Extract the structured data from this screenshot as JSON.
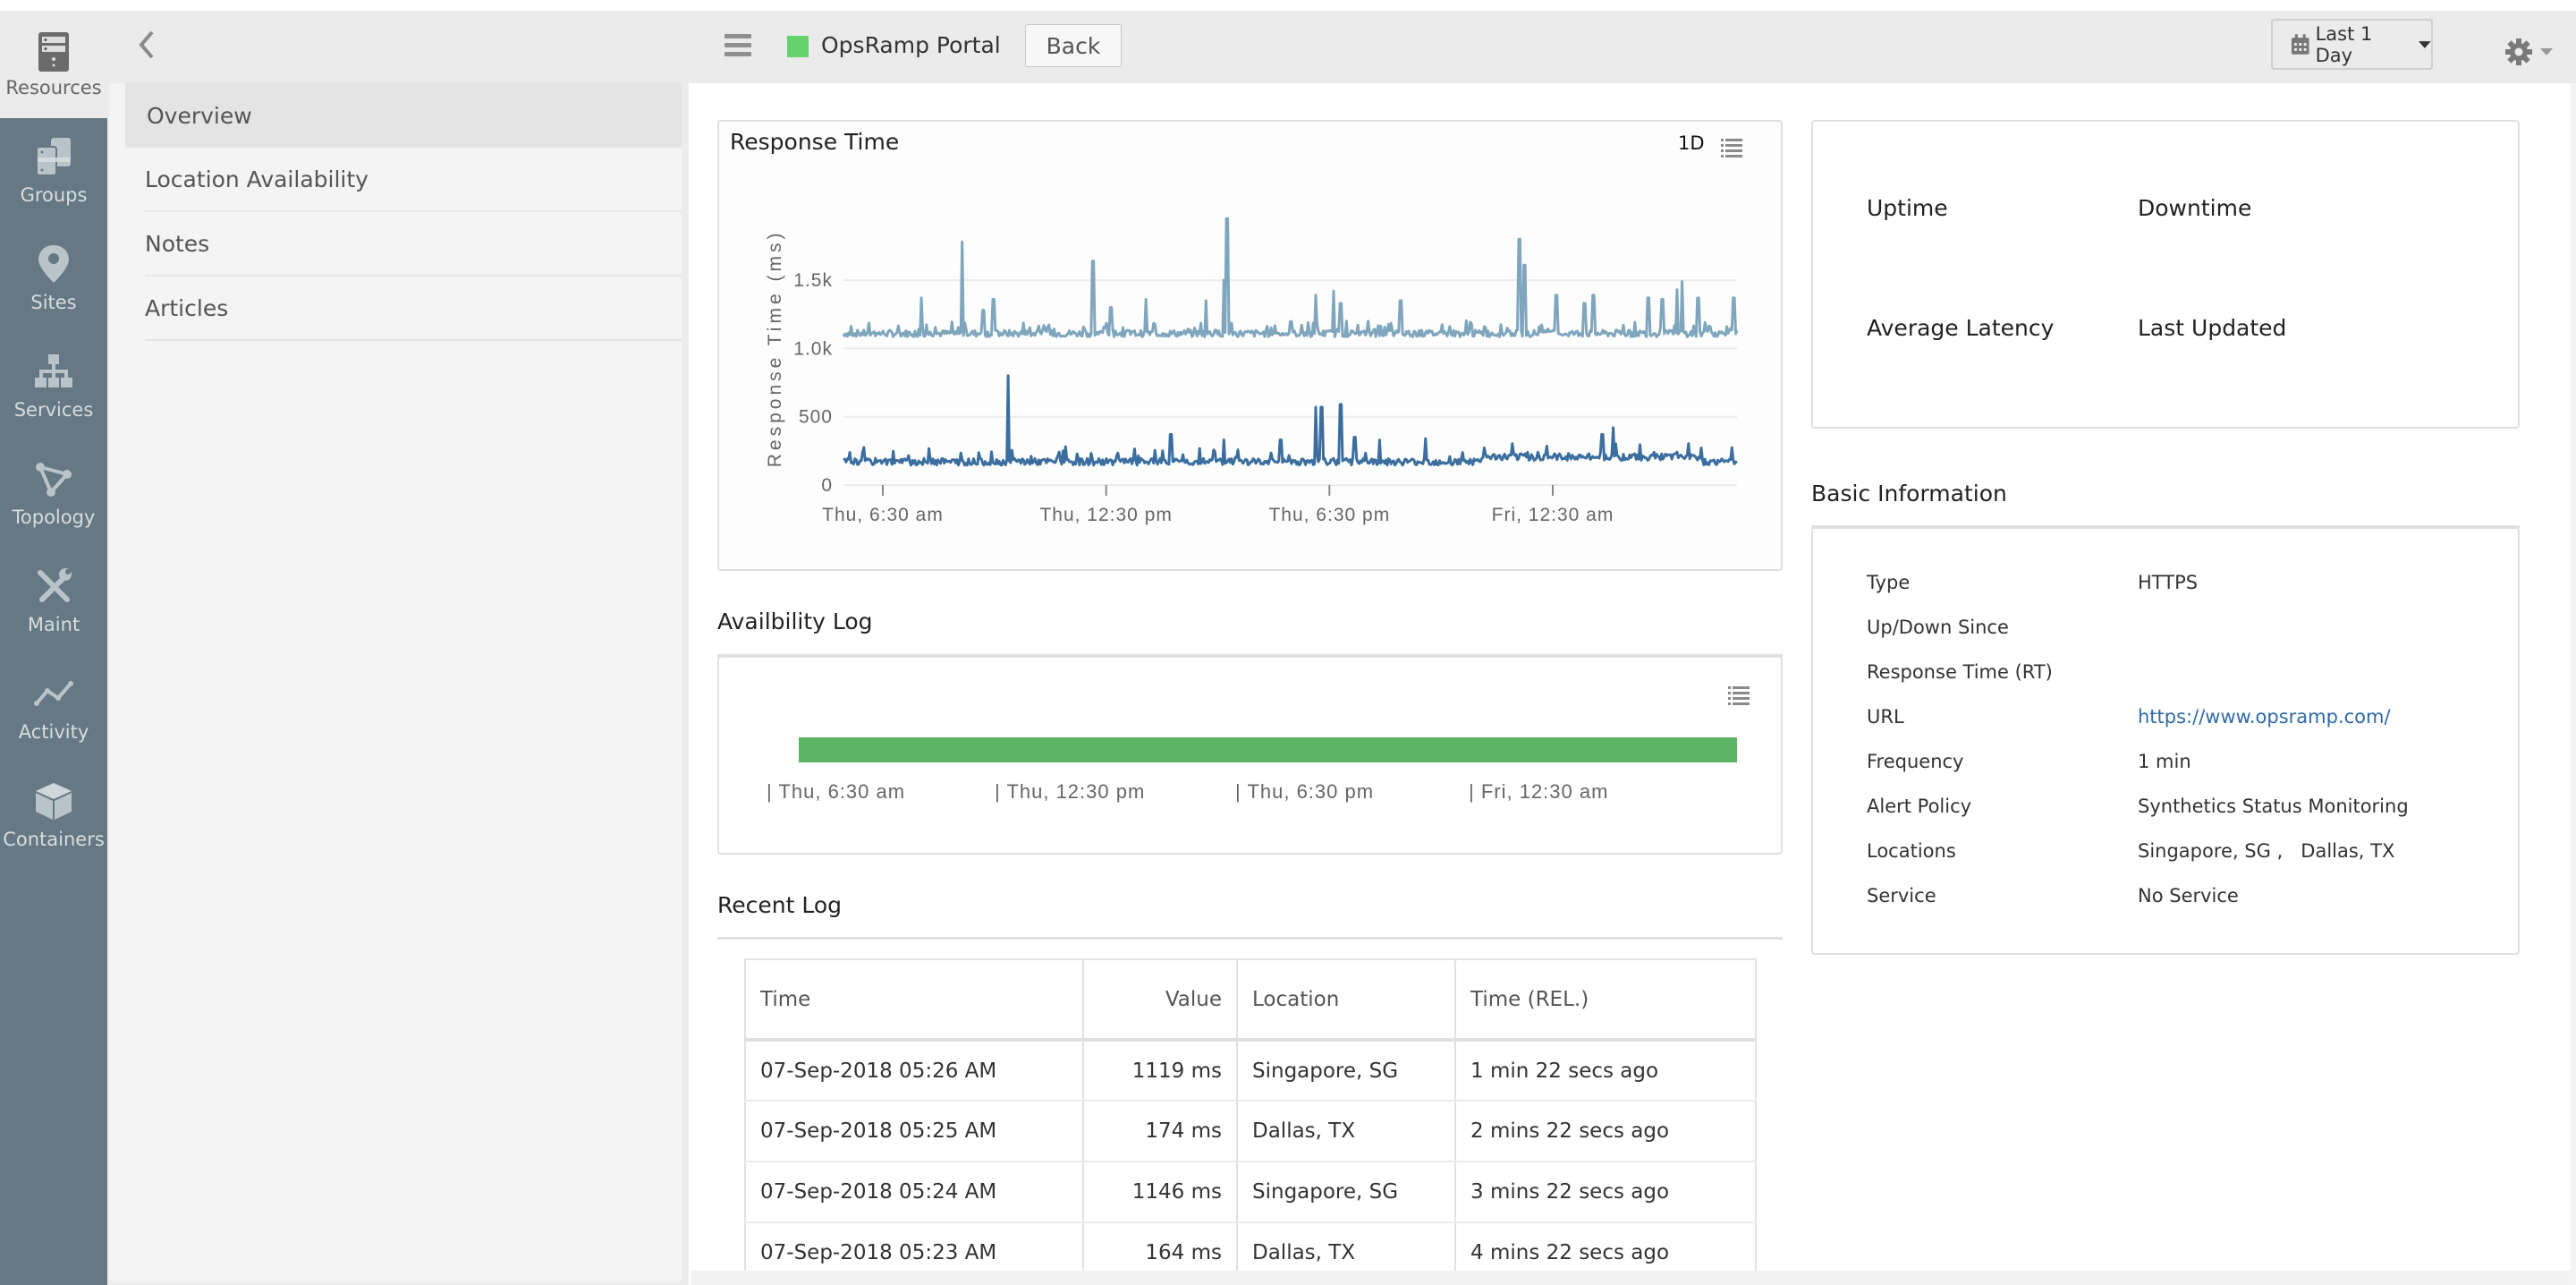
{
  "header": {
    "portal_name": "OpsRamp Portal",
    "status_color": "#63d46b",
    "back_label": "Back",
    "date_range_label": "Last 1 Day"
  },
  "sidebar": {
    "items": [
      {
        "label": "Resources",
        "icon": "server-icon",
        "active": true
      },
      {
        "label": "Groups",
        "icon": "groups-icon"
      },
      {
        "label": "Sites",
        "icon": "map-pin-icon"
      },
      {
        "label": "Services",
        "icon": "hierarchy-icon"
      },
      {
        "label": "Topology",
        "icon": "topology-icon"
      },
      {
        "label": "Maint",
        "icon": "wrench-icon"
      },
      {
        "label": "Activity",
        "icon": "activity-icon"
      },
      {
        "label": "Containers",
        "icon": "cube-icon"
      }
    ]
  },
  "subnav": {
    "items": [
      {
        "label": "Overview",
        "active": true
      },
      {
        "label": "Location Availability"
      },
      {
        "label": "Notes"
      },
      {
        "label": "Articles"
      }
    ]
  },
  "response_card": {
    "title": "Response Time",
    "period_label": "1D"
  },
  "availability": {
    "title": "Availbility Log",
    "bar_color": "#5cb565",
    "labels": [
      "Thu, 6:30 am",
      "Thu, 12:30 pm",
      "Thu, 6:30 pm",
      "Fri, 12:30 am"
    ]
  },
  "recent_log": {
    "title": "Recent Log",
    "columns": [
      "Time",
      "Value",
      "Location",
      "Time (REL.)"
    ],
    "rows": [
      [
        "07-Sep-2018 05:26 AM",
        "1119 ms",
        "Singapore, SG",
        "1 min 22 secs ago"
      ],
      [
        "07-Sep-2018 05:25 AM",
        "174 ms",
        "Dallas, TX",
        "2 mins 22 secs ago"
      ],
      [
        "07-Sep-2018 05:24 AM",
        "1146 ms",
        "Singapore, SG",
        "3 mins 22 secs ago"
      ],
      [
        "07-Sep-2018 05:23 AM",
        "164 ms",
        "Dallas, TX",
        "4 mins 22 secs ago"
      ]
    ]
  },
  "status_card": {
    "uptime_label": "Uptime",
    "downtime_label": "Downtime",
    "avg_latency_label": "Average Latency",
    "last_updated_label": "Last Updated"
  },
  "basic_info": {
    "title": "Basic Information",
    "rows": [
      {
        "label": "Type",
        "value": "HTTPS"
      },
      {
        "label": "Up/Down Since",
        "value": ""
      },
      {
        "label": "Response Time (RT)",
        "value": ""
      },
      {
        "label": "URL",
        "value": "https://www.opsramp.com/",
        "link": true
      },
      {
        "label": "Frequency",
        "value": "1 min"
      },
      {
        "label": "Alert Policy",
        "value": "Synthetics Status Monitoring"
      },
      {
        "label": "Locations",
        "value": "Singapore, SG ,   Dallas, TX"
      },
      {
        "label": "Service",
        "value": "No Service"
      }
    ]
  },
  "chart_data": {
    "type": "line",
    "title": "Response Time",
    "xlabel": "",
    "ylabel": "Response Time (ms)",
    "ylim": [
      0,
      2000
    ],
    "yticks": [
      0,
      500,
      1000,
      1500
    ],
    "ytick_labels": [
      "0",
      "500",
      "1.0k",
      "1.5k"
    ],
    "xlim_hours": [
      4.25,
      28.5
    ],
    "xticks_hours": [
      6.5,
      12.5,
      18.5,
      24.5
    ],
    "xtick_labels": [
      "Thu, 6:30 am",
      "Thu, 12:30 pm",
      "Thu, 6:30 pm",
      "Fri, 12:30 am"
    ],
    "grid": true,
    "legend": "none",
    "series": [
      {
        "name": "Singapore, SG",
        "color": "#7fa6bd",
        "baseline": 1110,
        "spikes": [
          [
            6.45,
            1370
          ],
          [
            7.6,
            1780
          ],
          [
            8.2,
            1280
          ],
          [
            8.5,
            1360
          ],
          [
            11.3,
            1640
          ],
          [
            11.8,
            1300
          ],
          [
            12.8,
            1360
          ],
          [
            14.5,
            1350
          ],
          [
            15.0,
            1500
          ],
          [
            15.1,
            1950
          ],
          [
            17.6,
            1390
          ],
          [
            18.1,
            1420
          ],
          [
            18.3,
            1330
          ],
          [
            20.0,
            1350
          ],
          [
            23.35,
            1800
          ],
          [
            23.5,
            1610
          ],
          [
            24.4,
            1390
          ],
          [
            25.2,
            1330
          ],
          [
            25.45,
            1390
          ],
          [
            27.0,
            1370
          ],
          [
            27.4,
            1360
          ],
          [
            27.8,
            1430
          ],
          [
            27.95,
            1490
          ],
          [
            28.4,
            1370
          ],
          [
            29.4,
            1370
          ]
        ]
      },
      {
        "name": "Dallas, TX",
        "color": "#3b6e9f",
        "baseline": 170,
        "spikes": [
          [
            8.9,
            800
          ],
          [
            13.5,
            370
          ],
          [
            15.0,
            330
          ],
          [
            16.6,
            330
          ],
          [
            17.6,
            570
          ],
          [
            17.75,
            570
          ],
          [
            18.3,
            590
          ],
          [
            18.7,
            350
          ],
          [
            19.4,
            330
          ],
          [
            20.7,
            340
          ],
          [
            25.7,
            370
          ],
          [
            26.0,
            420
          ],
          [
            30.0,
            610
          ]
        ]
      }
    ]
  }
}
